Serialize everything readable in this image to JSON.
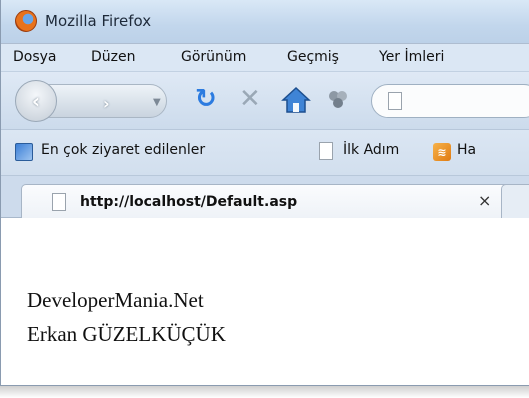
{
  "window": {
    "title": "Mozilla Firefox"
  },
  "menu": {
    "items": [
      {
        "label": "Dosya"
      },
      {
        "label": "Düzen"
      },
      {
        "label": "Görünüm"
      },
      {
        "label": "Geçmiş"
      },
      {
        "label": "Yer İmleri"
      }
    ]
  },
  "toolbar": {
    "back_icon": "back-arrow-icon",
    "forward_icon": "forward-arrow-icon",
    "reload_icon": "reload-icon",
    "stop_icon": "stop-icon",
    "home_icon": "home-icon",
    "addon_icon": "addon-icon"
  },
  "bookmarks": {
    "items": [
      {
        "label": "En çok ziyaret edilenler",
        "icon": "most-visited-icon"
      },
      {
        "label": "İlk Adım",
        "icon": "page-icon"
      },
      {
        "label": "Ha",
        "icon": "rss-icon"
      }
    ]
  },
  "tab": {
    "title": "http://localhost/Default.asp",
    "close_symbol": "×"
  },
  "content": {
    "lines": [
      "DeveloperMania.Net",
      "Erkan GÜZELKÜÇÜK"
    ]
  },
  "colors": {
    "chrome_blue": "#dbe7f4",
    "reload_blue": "#2c7be0",
    "firefox_orange": "#e8721c"
  }
}
